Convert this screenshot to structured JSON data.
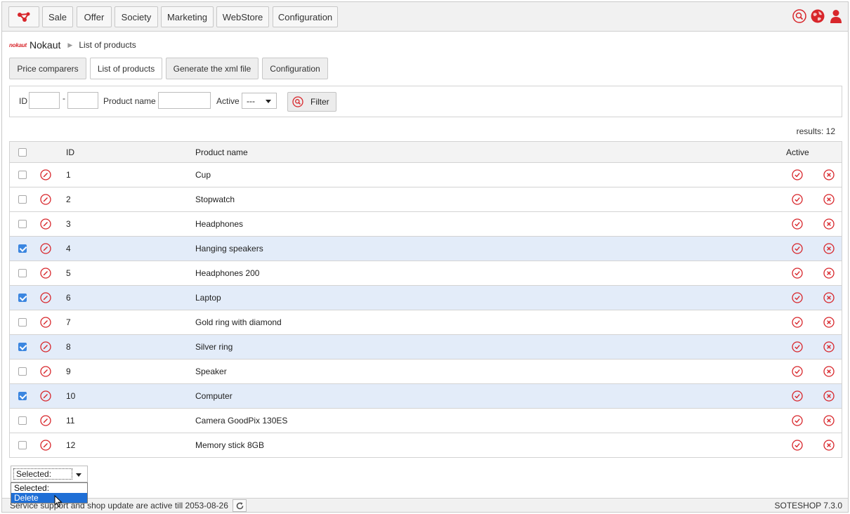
{
  "nav": {
    "items": [
      "Sale",
      "Offer",
      "Society",
      "Marketing",
      "WebStore",
      "Configuration"
    ],
    "icons": [
      "search-icon",
      "globe-icon",
      "user-icon"
    ]
  },
  "breadcrumb": {
    "root": "Nokaut",
    "logo_text": "nokaut",
    "current": "List of products"
  },
  "subtabs": [
    "Price comparers",
    "List of products",
    "Generate the xml file",
    "Configuration"
  ],
  "filter": {
    "id_label": "ID",
    "range_sep": "-",
    "id_from": "",
    "id_to": "",
    "name_label": "Product name",
    "name_value": "",
    "active_label": "Active",
    "active_value": "---",
    "button_label": "Filter"
  },
  "results_text": "results: 12",
  "table": {
    "headers": {
      "id": "ID",
      "name": "Product name",
      "active": "Active"
    },
    "rows": [
      {
        "id": "1",
        "name": "Cup",
        "checked": false
      },
      {
        "id": "2",
        "name": "Stopwatch",
        "checked": false
      },
      {
        "id": "3",
        "name": "Headphones",
        "checked": false
      },
      {
        "id": "4",
        "name": "Hanging speakers",
        "checked": true
      },
      {
        "id": "5",
        "name": "Headphones 200",
        "checked": false
      },
      {
        "id": "6",
        "name": "Laptop",
        "checked": true
      },
      {
        "id": "7",
        "name": "Gold ring with diamond",
        "checked": false
      },
      {
        "id": "8",
        "name": "Silver ring",
        "checked": true
      },
      {
        "id": "9",
        "name": "Speaker",
        "checked": false
      },
      {
        "id": "10",
        "name": "Computer",
        "checked": true
      },
      {
        "id": "11",
        "name": "Camera GoodPix 130ES",
        "checked": false
      },
      {
        "id": "12",
        "name": "Memory stick 8GB",
        "checked": false
      }
    ]
  },
  "bulk_action": {
    "selected": "Selected:",
    "options": [
      "Selected:",
      "Delete"
    ],
    "highlighted": "Delete"
  },
  "footer": {
    "message": "Service support and shop update are active till 2053-08-26",
    "version": "SOTESHOP 7.3.0"
  },
  "colors": {
    "accent_red": "#d8262b",
    "selected_row": "#e3ecf9",
    "option_highlight": "#1f6fd6"
  }
}
